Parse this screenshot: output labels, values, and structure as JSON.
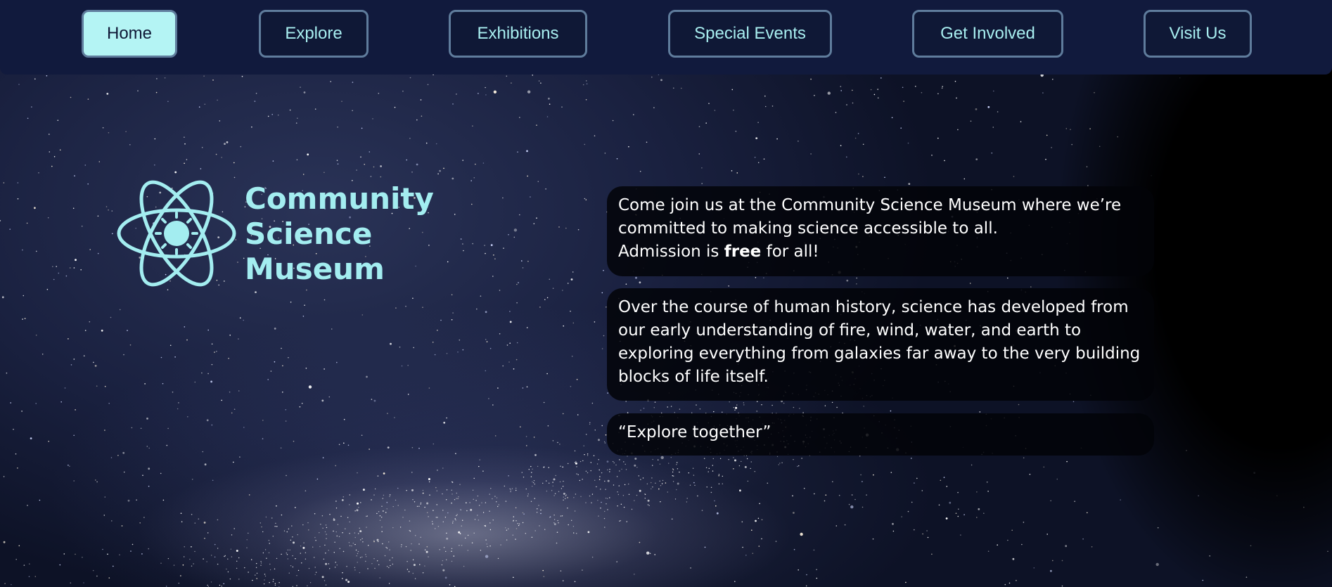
{
  "nav": {
    "items": [
      {
        "label": "Home",
        "active": true
      },
      {
        "label": "Explore",
        "active": false
      },
      {
        "label": "Exhibitions",
        "active": false
      },
      {
        "label": "Special Events",
        "active": false
      },
      {
        "label": "Get Involved",
        "active": false
      },
      {
        "label": "Visit Us",
        "active": false
      }
    ]
  },
  "logo": {
    "icon": "atom-sun-icon",
    "lines": [
      "Community",
      "Science",
      "Museum"
    ]
  },
  "intro": {
    "line1": "Come join us at the Community Science Museum where we’re committed to making science accessible to all.",
    "admission_prefix": "Admission is ",
    "admission_emphasis": "free",
    "admission_suffix": " for all!"
  },
  "history": {
    "text": "Over the course of human history, science has developed from our early understanding of fire, wind, water, and earth to exploring everything from galaxies far away to the very building blocks of life itself."
  },
  "tagline": {
    "text": "“Explore together”"
  },
  "colors": {
    "nav_background": "#111a3d",
    "accent_cyan": "#a8eef0",
    "active_button": "#b4f4f4",
    "button_border": "#5f7c9c",
    "card_background": "#020308"
  }
}
